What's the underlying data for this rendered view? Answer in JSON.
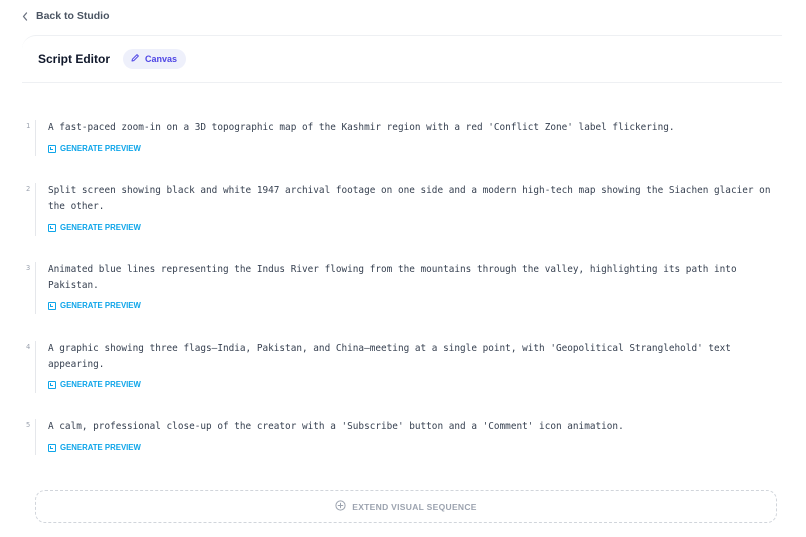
{
  "nav": {
    "back_label": "Back to Studio"
  },
  "header": {
    "title": "Script Editor",
    "canvas_label": "Canvas"
  },
  "scenes": [
    {
      "number": "1",
      "text": "A fast-paced zoom-in on a 3D topographic map of the Kashmir region with a red 'Conflict Zone' label flickering.",
      "action": "GENERATE PREVIEW"
    },
    {
      "number": "2",
      "text": "Split screen showing black and white 1947 archival footage on one side and a modern high-tech map showing the Siachen glacier on the other.",
      "action": "GENERATE PREVIEW"
    },
    {
      "number": "3",
      "text": "Animated blue lines representing the Indus River flowing from the mountains through the valley, highlighting its path into Pakistan.",
      "action": "GENERATE PREVIEW"
    },
    {
      "number": "4",
      "text": "A graphic showing three flags—India, Pakistan, and China—meeting at a single point, with 'Geopolitical Stranglehold' text appearing.",
      "action": "GENERATE PREVIEW"
    },
    {
      "number": "5",
      "text": "A calm, professional close-up of the creator with a 'Subscribe' button and a 'Comment' icon animation.",
      "action": "GENERATE PREVIEW"
    }
  ],
  "footer": {
    "extend_label": "EXTEND VISUAL SEQUENCE"
  },
  "colors": {
    "accent": "#4f46e5",
    "link": "#0ea5e9"
  }
}
